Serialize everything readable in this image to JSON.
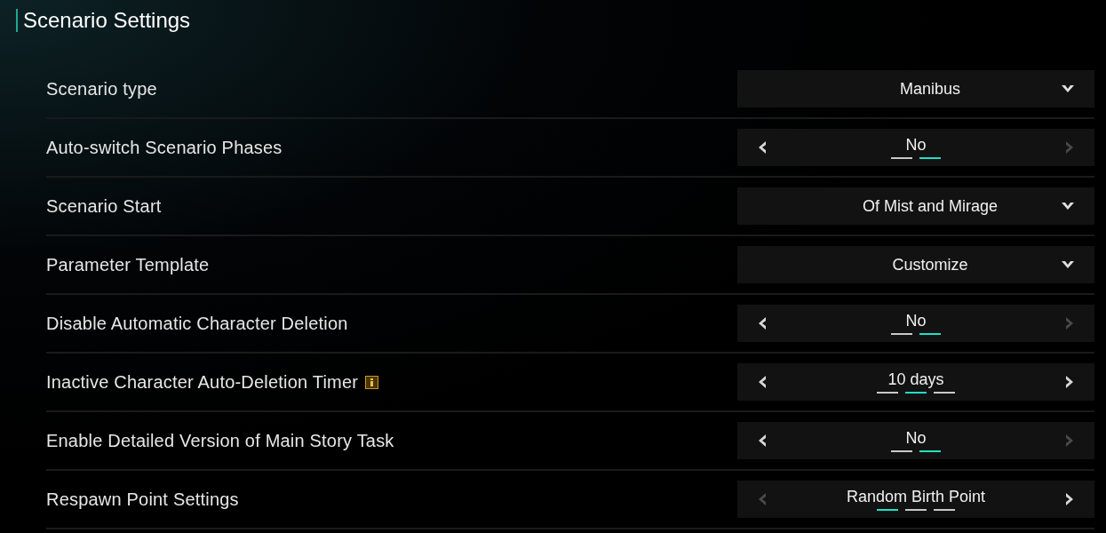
{
  "title": "Scenario Settings",
  "settings": [
    {
      "label": "Scenario type",
      "kind": "dropdown",
      "value": "Manibus"
    },
    {
      "label": "Auto-switch Scenario Phases",
      "kind": "stepper",
      "value": "No",
      "prev_disabled": false,
      "next_disabled": true,
      "options": [
        {
          "selected": false
        },
        {
          "selected": true
        }
      ]
    },
    {
      "label": "Scenario Start",
      "kind": "dropdown",
      "value": "Of Mist and Mirage"
    },
    {
      "label": "Parameter Template",
      "kind": "dropdown",
      "value": "Customize"
    },
    {
      "label": "Disable Automatic Character Deletion",
      "kind": "stepper",
      "value": "No",
      "prev_disabled": false,
      "next_disabled": true,
      "options": [
        {
          "selected": false
        },
        {
          "selected": true
        }
      ]
    },
    {
      "label": "Inactive Character Auto-Deletion Timer",
      "kind": "stepper",
      "info": true,
      "value": "10 days",
      "prev_disabled": false,
      "next_disabled": false,
      "options": [
        {
          "selected": false
        },
        {
          "selected": true
        },
        {
          "selected": false
        }
      ]
    },
    {
      "label": "Enable Detailed Version of Main Story Task",
      "kind": "stepper",
      "value": "No",
      "prev_disabled": false,
      "next_disabled": true,
      "options": [
        {
          "selected": false
        },
        {
          "selected": true
        }
      ]
    },
    {
      "label": "Respawn Point Settings",
      "kind": "stepper",
      "value": "Random Birth Point",
      "prev_disabled": true,
      "next_disabled": false,
      "options": [
        {
          "selected": true
        },
        {
          "selected": false
        },
        {
          "selected": false
        }
      ]
    }
  ]
}
